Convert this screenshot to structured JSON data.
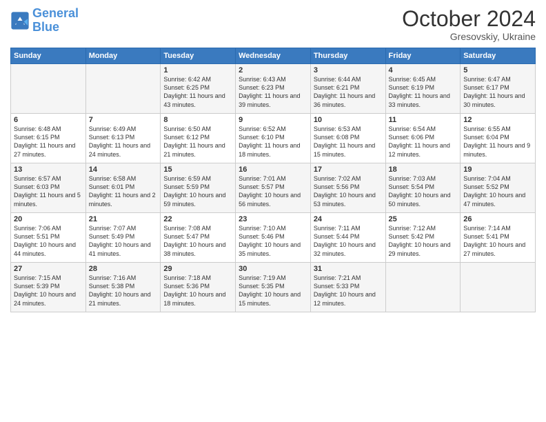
{
  "logo": {
    "line1": "General",
    "line2": "Blue"
  },
  "title": "October 2024",
  "location": "Gresovskiy, Ukraine",
  "days_header": [
    "Sunday",
    "Monday",
    "Tuesday",
    "Wednesday",
    "Thursday",
    "Friday",
    "Saturday"
  ],
  "weeks": [
    [
      {
        "num": "",
        "sunrise": "",
        "sunset": "",
        "daylight": ""
      },
      {
        "num": "",
        "sunrise": "",
        "sunset": "",
        "daylight": ""
      },
      {
        "num": "1",
        "sunrise": "Sunrise: 6:42 AM",
        "sunset": "Sunset: 6:25 PM",
        "daylight": "Daylight: 11 hours and 43 minutes."
      },
      {
        "num": "2",
        "sunrise": "Sunrise: 6:43 AM",
        "sunset": "Sunset: 6:23 PM",
        "daylight": "Daylight: 11 hours and 39 minutes."
      },
      {
        "num": "3",
        "sunrise": "Sunrise: 6:44 AM",
        "sunset": "Sunset: 6:21 PM",
        "daylight": "Daylight: 11 hours and 36 minutes."
      },
      {
        "num": "4",
        "sunrise": "Sunrise: 6:45 AM",
        "sunset": "Sunset: 6:19 PM",
        "daylight": "Daylight: 11 hours and 33 minutes."
      },
      {
        "num": "5",
        "sunrise": "Sunrise: 6:47 AM",
        "sunset": "Sunset: 6:17 PM",
        "daylight": "Daylight: 11 hours and 30 minutes."
      }
    ],
    [
      {
        "num": "6",
        "sunrise": "Sunrise: 6:48 AM",
        "sunset": "Sunset: 6:15 PM",
        "daylight": "Daylight: 11 hours and 27 minutes."
      },
      {
        "num": "7",
        "sunrise": "Sunrise: 6:49 AM",
        "sunset": "Sunset: 6:13 PM",
        "daylight": "Daylight: 11 hours and 24 minutes."
      },
      {
        "num": "8",
        "sunrise": "Sunrise: 6:50 AM",
        "sunset": "Sunset: 6:12 PM",
        "daylight": "Daylight: 11 hours and 21 minutes."
      },
      {
        "num": "9",
        "sunrise": "Sunrise: 6:52 AM",
        "sunset": "Sunset: 6:10 PM",
        "daylight": "Daylight: 11 hours and 18 minutes."
      },
      {
        "num": "10",
        "sunrise": "Sunrise: 6:53 AM",
        "sunset": "Sunset: 6:08 PM",
        "daylight": "Daylight: 11 hours and 15 minutes."
      },
      {
        "num": "11",
        "sunrise": "Sunrise: 6:54 AM",
        "sunset": "Sunset: 6:06 PM",
        "daylight": "Daylight: 11 hours and 12 minutes."
      },
      {
        "num": "12",
        "sunrise": "Sunrise: 6:55 AM",
        "sunset": "Sunset: 6:04 PM",
        "daylight": "Daylight: 11 hours and 9 minutes."
      }
    ],
    [
      {
        "num": "13",
        "sunrise": "Sunrise: 6:57 AM",
        "sunset": "Sunset: 6:03 PM",
        "daylight": "Daylight: 11 hours and 5 minutes."
      },
      {
        "num": "14",
        "sunrise": "Sunrise: 6:58 AM",
        "sunset": "Sunset: 6:01 PM",
        "daylight": "Daylight: 11 hours and 2 minutes."
      },
      {
        "num": "15",
        "sunrise": "Sunrise: 6:59 AM",
        "sunset": "Sunset: 5:59 PM",
        "daylight": "Daylight: 10 hours and 59 minutes."
      },
      {
        "num": "16",
        "sunrise": "Sunrise: 7:01 AM",
        "sunset": "Sunset: 5:57 PM",
        "daylight": "Daylight: 10 hours and 56 minutes."
      },
      {
        "num": "17",
        "sunrise": "Sunrise: 7:02 AM",
        "sunset": "Sunset: 5:56 PM",
        "daylight": "Daylight: 10 hours and 53 minutes."
      },
      {
        "num": "18",
        "sunrise": "Sunrise: 7:03 AM",
        "sunset": "Sunset: 5:54 PM",
        "daylight": "Daylight: 10 hours and 50 minutes."
      },
      {
        "num": "19",
        "sunrise": "Sunrise: 7:04 AM",
        "sunset": "Sunset: 5:52 PM",
        "daylight": "Daylight: 10 hours and 47 minutes."
      }
    ],
    [
      {
        "num": "20",
        "sunrise": "Sunrise: 7:06 AM",
        "sunset": "Sunset: 5:51 PM",
        "daylight": "Daylight: 10 hours and 44 minutes."
      },
      {
        "num": "21",
        "sunrise": "Sunrise: 7:07 AM",
        "sunset": "Sunset: 5:49 PM",
        "daylight": "Daylight: 10 hours and 41 minutes."
      },
      {
        "num": "22",
        "sunrise": "Sunrise: 7:08 AM",
        "sunset": "Sunset: 5:47 PM",
        "daylight": "Daylight: 10 hours and 38 minutes."
      },
      {
        "num": "23",
        "sunrise": "Sunrise: 7:10 AM",
        "sunset": "Sunset: 5:46 PM",
        "daylight": "Daylight: 10 hours and 35 minutes."
      },
      {
        "num": "24",
        "sunrise": "Sunrise: 7:11 AM",
        "sunset": "Sunset: 5:44 PM",
        "daylight": "Daylight: 10 hours and 32 minutes."
      },
      {
        "num": "25",
        "sunrise": "Sunrise: 7:12 AM",
        "sunset": "Sunset: 5:42 PM",
        "daylight": "Daylight: 10 hours and 29 minutes."
      },
      {
        "num": "26",
        "sunrise": "Sunrise: 7:14 AM",
        "sunset": "Sunset: 5:41 PM",
        "daylight": "Daylight: 10 hours and 27 minutes."
      }
    ],
    [
      {
        "num": "27",
        "sunrise": "Sunrise: 7:15 AM",
        "sunset": "Sunset: 5:39 PM",
        "daylight": "Daylight: 10 hours and 24 minutes."
      },
      {
        "num": "28",
        "sunrise": "Sunrise: 7:16 AM",
        "sunset": "Sunset: 5:38 PM",
        "daylight": "Daylight: 10 hours and 21 minutes."
      },
      {
        "num": "29",
        "sunrise": "Sunrise: 7:18 AM",
        "sunset": "Sunset: 5:36 PM",
        "daylight": "Daylight: 10 hours and 18 minutes."
      },
      {
        "num": "30",
        "sunrise": "Sunrise: 7:19 AM",
        "sunset": "Sunset: 5:35 PM",
        "daylight": "Daylight: 10 hours and 15 minutes."
      },
      {
        "num": "31",
        "sunrise": "Sunrise: 7:21 AM",
        "sunset": "Sunset: 5:33 PM",
        "daylight": "Daylight: 10 hours and 12 minutes."
      },
      {
        "num": "",
        "sunrise": "",
        "sunset": "",
        "daylight": ""
      },
      {
        "num": "",
        "sunrise": "",
        "sunset": "",
        "daylight": ""
      }
    ]
  ]
}
